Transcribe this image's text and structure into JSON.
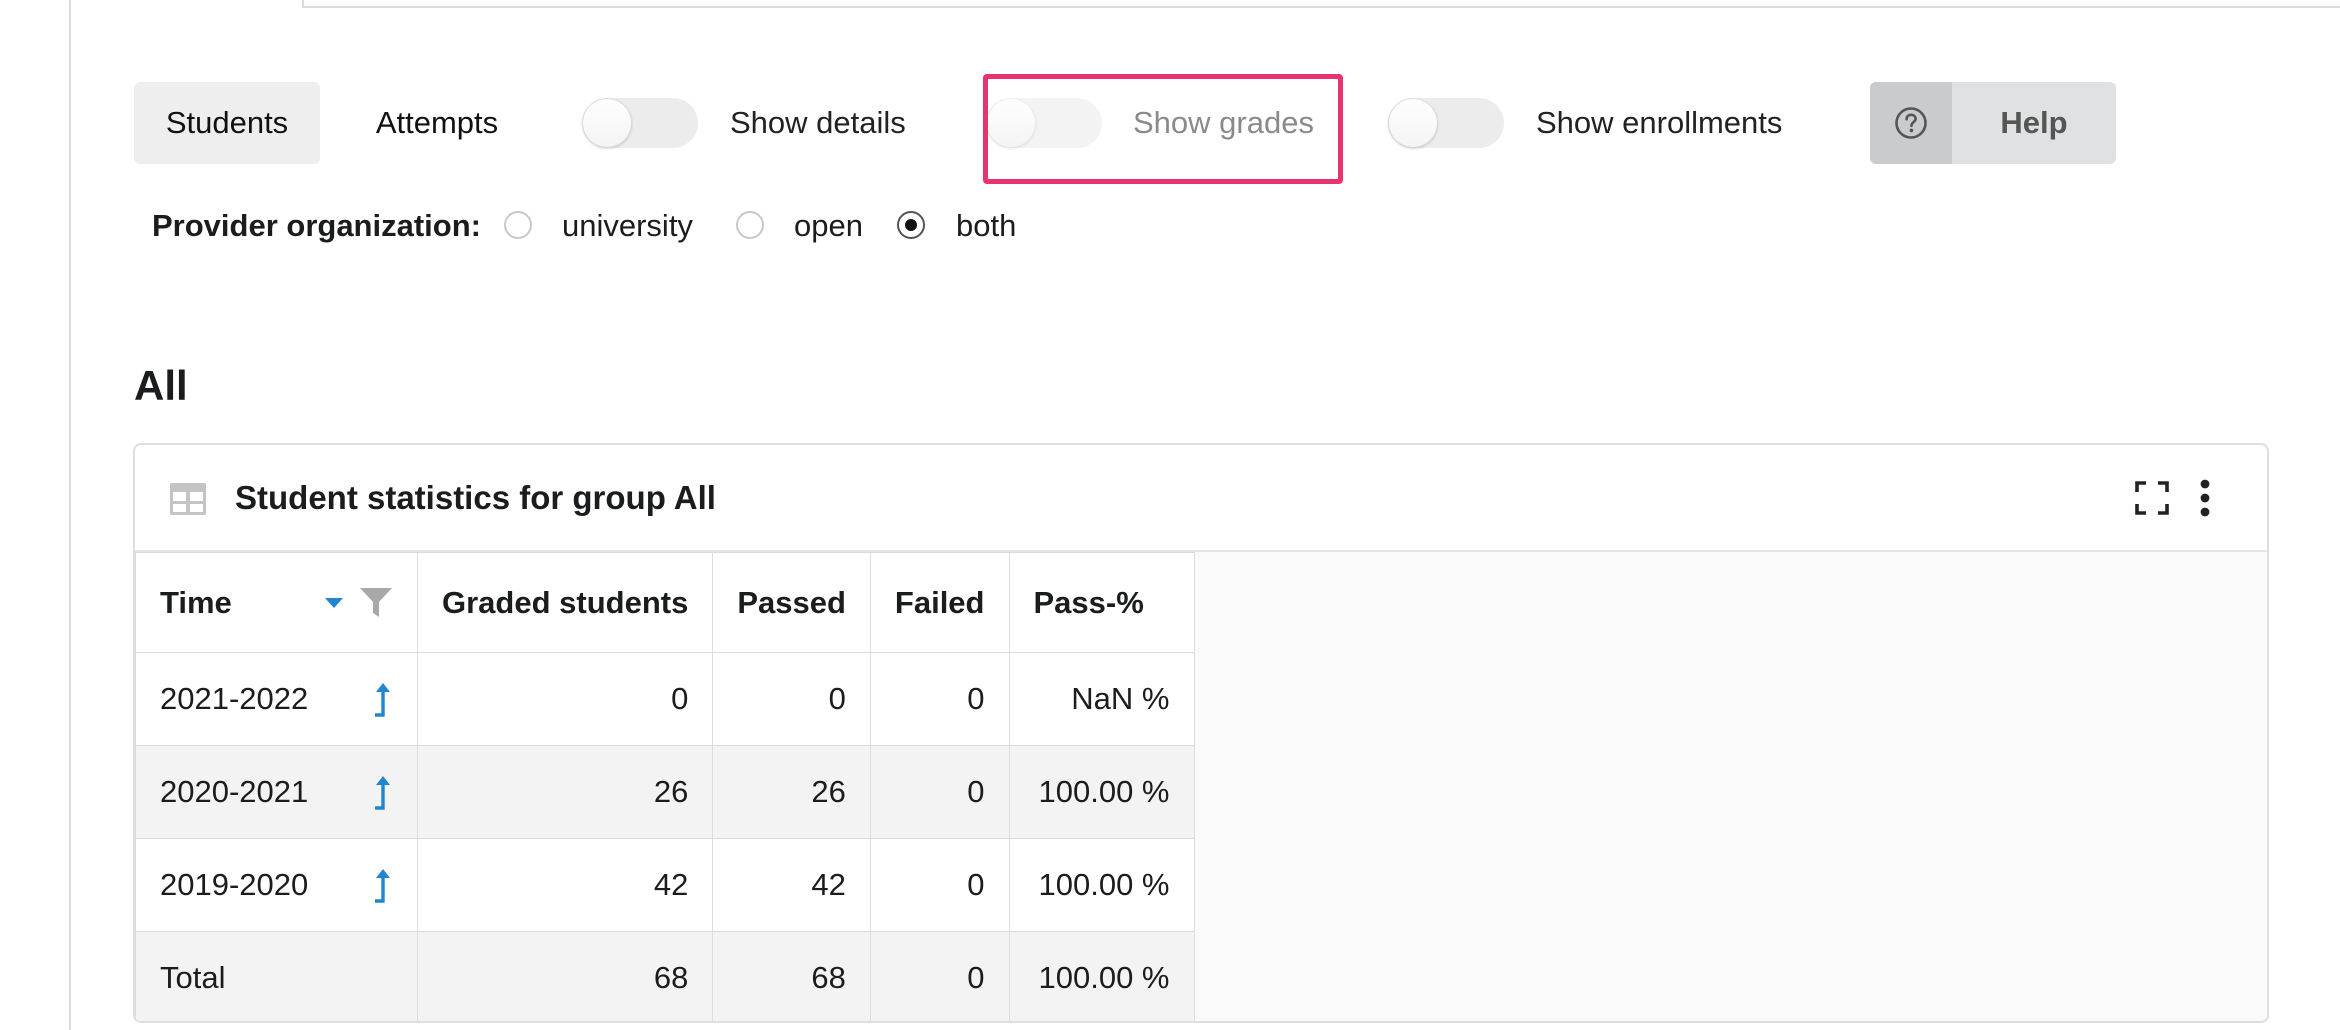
{
  "toolbar": {
    "tabs": [
      {
        "label": "Students",
        "active": true
      },
      {
        "label": "Attempts",
        "active": false
      }
    ],
    "toggles": [
      {
        "label": "Show details",
        "on": false
      },
      {
        "label": "Show grades",
        "on": false,
        "disabled": true
      },
      {
        "label": "Show enrollments",
        "on": false
      }
    ],
    "help_label": "Help",
    "help_icon": "question-circle-icon"
  },
  "provider": {
    "label": "Provider organization:",
    "options": [
      {
        "label": "university",
        "selected": false
      },
      {
        "label": "open",
        "selected": false
      },
      {
        "label": "both",
        "selected": true
      }
    ]
  },
  "section": {
    "title": "All"
  },
  "card": {
    "title": "Student statistics for group All",
    "icons": [
      "table-icon",
      "fullscreen-icon",
      "more-vertical-icon"
    ]
  },
  "table": {
    "columns": [
      "Time",
      "Graded students",
      "Passed",
      "Failed",
      "Pass-%"
    ],
    "rows": [
      {
        "time": "2021-2022",
        "graded": "0",
        "passed": "0",
        "failed": "0",
        "pass_pct": "NaN %"
      },
      {
        "time": "2020-2021",
        "graded": "26",
        "passed": "26",
        "failed": "0",
        "pass_pct": "100.00 %"
      },
      {
        "time": "2019-2020",
        "graded": "42",
        "passed": "42",
        "failed": "0",
        "pass_pct": "100.00 %"
      }
    ],
    "total": {
      "time": "Total",
      "graded": "68",
      "passed": "68",
      "failed": "0",
      "pass_pct": "100.00 %"
    }
  },
  "colors": {
    "highlight": "#e8336e",
    "accent_blue": "#2185d0"
  }
}
